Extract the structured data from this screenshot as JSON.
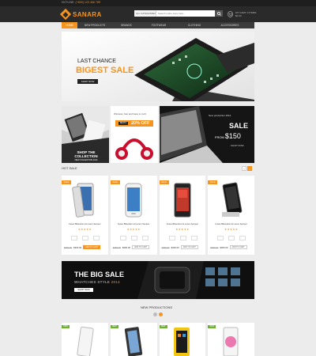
{
  "topbar": {
    "hotline_label": "HOTLINE:",
    "hotline_number": "(+800) 123 456 789"
  },
  "header": {
    "logo": "SANARA",
    "search": {
      "category": "ALL CATEGORIES",
      "placeholder": "Search entire store here..."
    },
    "cart": {
      "line1": "MY CART: 0 ITEMS",
      "line2": "$0.00"
    }
  },
  "nav": {
    "items": [
      "HOME",
      "NEW PRODUCTS",
      "BRANDS",
      "FOOTWEAR",
      "CLOTHING",
      "ACCESSORIES"
    ]
  },
  "hero": {
    "line1": "LAST CHANCE",
    "line2": "BIGEST SALE",
    "button": "SHOP NOW"
  },
  "banners": {
    "collection": {
      "title": "SHOP THE COLLECTION",
      "sub": "NEW COLLECTION 2014"
    },
    "headphones": {
      "top": "Wireless, fast and bass to curb",
      "tag": "BEATS",
      "off": "20% OFF"
    },
    "laptop": {
      "new": "New production 2014",
      "sale": "SALE",
      "from_label": "FROM",
      "price": "$150",
      "shop": "SHOP NOW"
    }
  },
  "hot_sale": {
    "title": "HOT SALE",
    "arrows": [
      "‹",
      "›"
    ],
    "products": [
      {
        "sale": "SALE",
        "name": "Fusce Bibendum At Lorem Semper",
        "stars": "★★★★★",
        "old_price": "$350.00",
        "new_price": "$300.00",
        "add": "ADD TO CART",
        "active": true
      },
      {
        "sale": "SALE",
        "name": "Fusce Bibendum At Lorem Semper",
        "stars": "★★★★★",
        "old_price": "$350.00",
        "new_price": "$300.00",
        "add": "ADD TO CART",
        "active": false
      },
      {
        "sale": "SALE",
        "name": "Fusce Bibendum At Lorem Semper",
        "stars": "★★★★★",
        "old_price": "$350.00",
        "new_price": "$300.00",
        "add": "ADD TO CART",
        "active": false
      },
      {
        "sale": "SALE",
        "name": "Fusce Bibendum At Lorem Semper",
        "stars": "★★★★★",
        "old_price": "$350.00",
        "new_price": "$300.00",
        "add": "ADD TO CART",
        "active": false
      }
    ]
  },
  "big_sale": {
    "title": "THE BIG SALE",
    "subtitle": "WHATCHES STYLE",
    "year": "2014",
    "button": "SHOP NOW"
  },
  "new_productions": {
    "title": "NEW PRODUCTIONS",
    "tags": [
      "NEW",
      "NEW",
      "NEW",
      "NEW"
    ]
  },
  "colors": {
    "accent": "#f7941d",
    "dark": "#2a2a2a",
    "new_tag": "#6bb32e"
  }
}
